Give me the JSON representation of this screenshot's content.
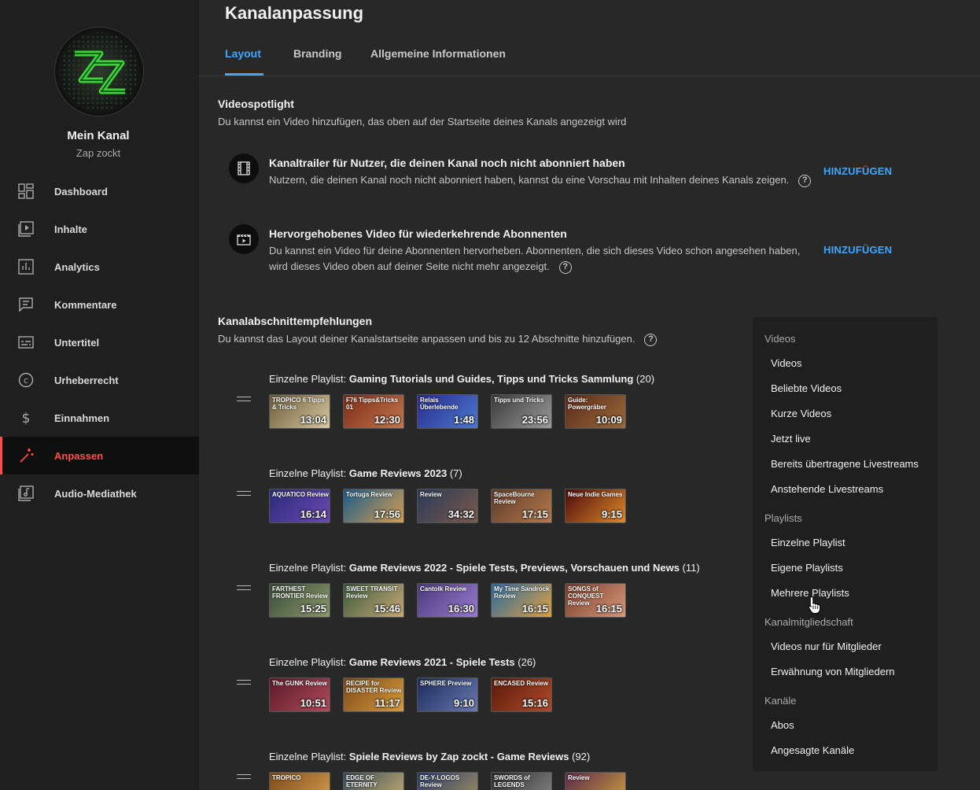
{
  "sidebar": {
    "channel_name": "Mein Kanal",
    "channel_handle": "Zap zockt",
    "items": [
      {
        "label": "Dashboard",
        "icon": "dashboard-icon"
      },
      {
        "label": "Inhalte",
        "icon": "content-icon"
      },
      {
        "label": "Analytics",
        "icon": "analytics-icon"
      },
      {
        "label": "Kommentare",
        "icon": "comments-icon"
      },
      {
        "label": "Untertitel",
        "icon": "subtitles-icon"
      },
      {
        "label": "Urheberrecht",
        "icon": "copyright-icon"
      },
      {
        "label": "Einnahmen",
        "icon": "dollar-icon"
      },
      {
        "label": "Anpassen",
        "icon": "magic-wand-icon",
        "active": true
      },
      {
        "label": "Audio-Mediathek",
        "icon": "audio-library-icon"
      }
    ]
  },
  "header": {
    "title": "Kanalanpassung",
    "tabs": [
      {
        "label": "Layout",
        "active": true
      },
      {
        "label": "Branding"
      },
      {
        "label": "Allgemeine Informationen"
      }
    ]
  },
  "spotlight": {
    "title": "Videospotlight",
    "subtitle": "Du kannst ein Video hinzufügen, das oben auf der Startseite deines Kanals angezeigt wird",
    "trailer_title": "Kanaltrailer für Nutzer, die deinen Kanal noch nicht abonniert haben",
    "trailer_desc": "Nutzern, die deinen Kanal noch nicht abonniert haben, kannst du eine Vorschau mit Inhalten deines Kanals zeigen.",
    "featured_title": "Hervorgehobenes Video für wiederkehrende Abonnenten",
    "featured_desc": "Du kannst ein Video für deine Abonnenten hervorheben. Abonnenten, die sich dieses Video schon angesehen haben, wird dieses Video oben auf deiner Seite nicht mehr angezeigt.",
    "add_label": "HINZUFÜGEN",
    "help_glyph": "?"
  },
  "sections": {
    "title": "Kanalabschnittempfehlungen",
    "subtitle": "Du kannst das Layout deiner Kanalstartseite anpassen und bis zu 12 Abschnitte hinzufügen.",
    "prefix": "Einzelne Playlist: ",
    "playlists": [
      {
        "name": "Gaming Tutorials und Guides, Tipps und Tricks Sammlung",
        "count": " (20)",
        "thumbs": [
          {
            "dur": "13:04",
            "cap": "TROPICO 6 Tipps & Tricks",
            "c1": "#6a5a3a",
            "c2": "#d8c9a0"
          },
          {
            "dur": "12:30",
            "cap": "F76 Tipps&Tricks 01",
            "c1": "#7a2a1a",
            "c2": "#c4784a"
          },
          {
            "dur": "1:48",
            "cap": "Relais Überlebende",
            "c1": "#2a2a8a",
            "c2": "#4a7ad0"
          },
          {
            "dur": "23:56",
            "cap": "Tipps und Tricks",
            "c1": "#3a3a3a",
            "c2": "#9a9a9a"
          },
          {
            "dur": "10:09",
            "cap": "Guide: Powergräber",
            "c1": "#5a2a1a",
            "c2": "#9a6a3a"
          }
        ]
      },
      {
        "name": "Game Reviews 2023",
        "count": " (7)",
        "thumbs": [
          {
            "dur": "16:14",
            "cap": "AQUATICO Review",
            "c1": "#2a2a7a",
            "c2": "#6a4ab0"
          },
          {
            "dur": "17:56",
            "cap": "Tortuga Review",
            "c1": "#1a5a8a",
            "c2": "#d8a050"
          },
          {
            "dur": "34:32",
            "cap": "Review",
            "c1": "#2a3a5a",
            "c2": "#7a5a4a"
          },
          {
            "dur": "17:15",
            "cap": "SpaceBourne Review",
            "c1": "#5a3a2a",
            "c2": "#b87a4a"
          },
          {
            "dur": "9:15",
            "cap": "Neue Indie Games",
            "c1": "#4a0a0a",
            "c2": "#e08a2a"
          }
        ]
      },
      {
        "name": "Game Reviews 2022 - Spiele Tests, Previews, Vorschauen und News",
        "count": " (11)",
        "thumbs": [
          {
            "dur": "15:25",
            "cap": "FARTHEST FRONTIER Review",
            "c1": "#3a4a3a",
            "c2": "#8a9a6a"
          },
          {
            "dur": "15:46",
            "cap": "SWEET TRANSIT Review",
            "c1": "#3a5a3a",
            "c2": "#c8a878"
          },
          {
            "dur": "16:30",
            "cap": "Cantolk Review",
            "c1": "#4a3a7a",
            "c2": "#9a7ad0"
          },
          {
            "dur": "16:15",
            "cap": "My Time Sandrock Review",
            "c1": "#2a6aa0",
            "c2": "#e0a040"
          },
          {
            "dur": "16:15",
            "cap": "SONGS of CONQUEST Review",
            "c1": "#7a3a2a",
            "c2": "#d89a7a"
          }
        ]
      },
      {
        "name": "Game Reviews 2021 - Spiele Tests",
        "count": " (26)",
        "thumbs": [
          {
            "dur": "10:51",
            "cap": "The GUNK Review",
            "c1": "#5a1a2a",
            "c2": "#b04a5a"
          },
          {
            "dur": "11:17",
            "cap": "RECIPE for DISASTER Review",
            "c1": "#7a4a1a",
            "c2": "#d89a3a"
          },
          {
            "dur": "9:10",
            "cap": "SPHERE Preview",
            "c1": "#1a2a5a",
            "c2": "#6a7ab0"
          },
          {
            "dur": "15:16",
            "cap": "ENCASED Review",
            "c1": "#5a1a0a",
            "c2": "#b04a2a"
          }
        ]
      },
      {
        "name": "Spiele Reviews by Zap zockt - Game Reviews",
        "count": " (92)",
        "thumbs": [
          {
            "dur": "",
            "cap": "TROPICO",
            "c1": "#7a4a1a",
            "c2": "#d8a050"
          },
          {
            "dur": "",
            "cap": "EDGE OF ETERNITY",
            "c1": "#3a4a5a",
            "c2": "#c8b070"
          },
          {
            "dur": "",
            "cap": "DE-Y-LOGOS Review",
            "c1": "#2a3a6a",
            "c2": "#a09060"
          },
          {
            "dur": "",
            "cap": "SWORDS of LEGENDS",
            "c1": "#2a2a2a",
            "c2": "#8a8a8a"
          },
          {
            "dur": "",
            "cap": "Review",
            "c1": "#5a2a4a",
            "c2": "#d0a040"
          }
        ]
      }
    ]
  },
  "menu": {
    "groups": [
      {
        "label": "Videos",
        "items": [
          "Videos",
          "Beliebte Videos",
          "Kurze Videos",
          "Jetzt live",
          "Bereits übertragene Livestreams",
          "Anstehende Livestreams"
        ]
      },
      {
        "label": "Playlists",
        "items": [
          "Einzelne Playlist",
          "Eigene Playlists",
          "Mehrere Playlists"
        ]
      },
      {
        "label": "Kanalmitgliedschaft",
        "items": [
          "Videos nur für Mitglieder",
          "Erwähnung von Mitgliedern"
        ]
      },
      {
        "label": "Kanäle",
        "items": [
          "Abos",
          "Angesagte Kanäle"
        ]
      }
    ]
  },
  "colors": {
    "accent": "#3ea6ff",
    "active_nav": "#ff4e45",
    "background": "#282828",
    "sidebar": "#1f1f1f"
  }
}
